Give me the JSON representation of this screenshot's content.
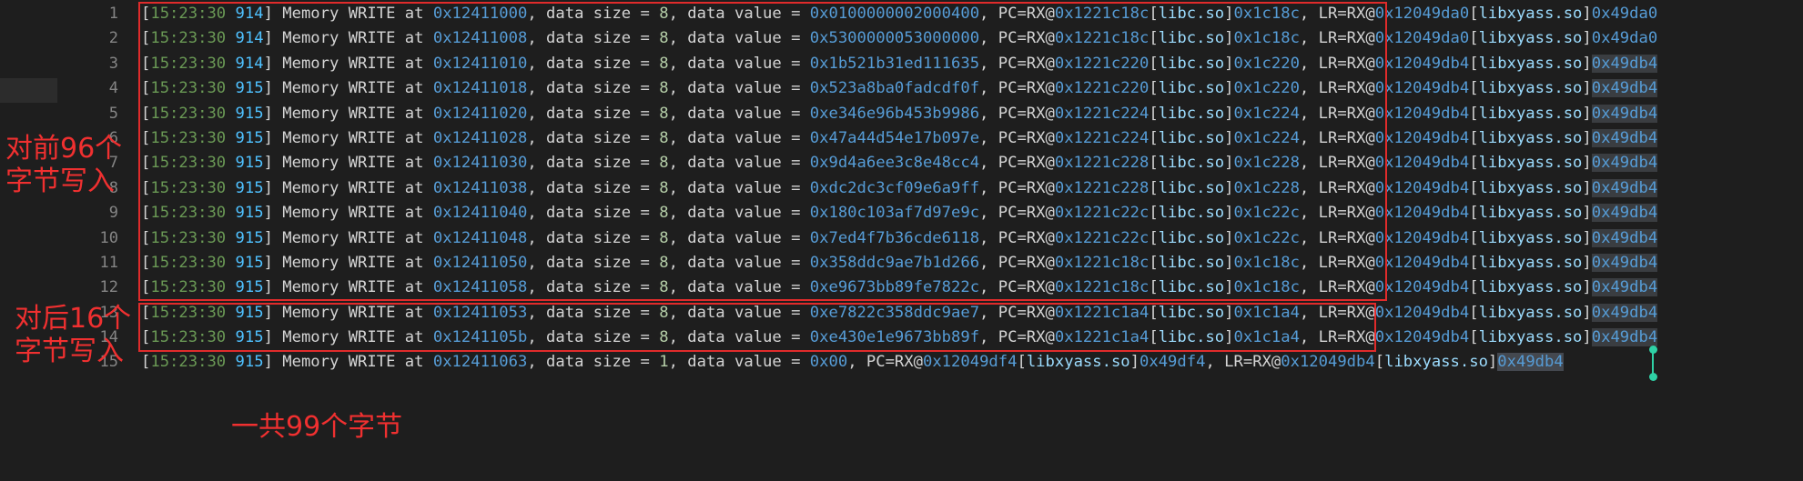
{
  "gutter": {
    "line_numbers": [
      "1",
      "2",
      "3",
      "4",
      "5",
      "6",
      "7",
      "8",
      "9",
      "10",
      "11",
      "12",
      "13",
      "14",
      "15"
    ]
  },
  "log_lines": [
    {
      "ts": "15:23:30",
      "ms": "914",
      "addr": "0x12411000",
      "size": "8",
      "value": "0x0100000002000400",
      "pc": "0x1221c18c",
      "pc_lib": "libc.so",
      "pc_off": "0x1c18c",
      "lr": "0x12049da0",
      "lr_lib": "libxyass.so",
      "lr_off": "0x49da0"
    },
    {
      "ts": "15:23:30",
      "ms": "914",
      "addr": "0x12411008",
      "size": "8",
      "value": "0x5300000053000000",
      "pc": "0x1221c18c",
      "pc_lib": "libc.so",
      "pc_off": "0x1c18c",
      "lr": "0x12049da0",
      "lr_lib": "libxyass.so",
      "lr_off": "0x49da0"
    },
    {
      "ts": "15:23:30",
      "ms": "914",
      "addr": "0x12411010",
      "size": "8",
      "value": "0x1b521b31ed111635",
      "pc": "0x1221c220",
      "pc_lib": "libc.so",
      "pc_off": "0x1c220",
      "lr": "0x12049db4",
      "lr_lib": "libxyass.so",
      "lr_off": "0x49db4"
    },
    {
      "ts": "15:23:30",
      "ms": "915",
      "addr": "0x12411018",
      "size": "8",
      "value": "0x523a8ba0fadcdf0f",
      "pc": "0x1221c220",
      "pc_lib": "libc.so",
      "pc_off": "0x1c220",
      "lr": "0x12049db4",
      "lr_lib": "libxyass.so",
      "lr_off": "0x49db4"
    },
    {
      "ts": "15:23:30",
      "ms": "915",
      "addr": "0x12411020",
      "size": "8",
      "value": "0xe346e96b453b9986",
      "pc": "0x1221c224",
      "pc_lib": "libc.so",
      "pc_off": "0x1c224",
      "lr": "0x12049db4",
      "lr_lib": "libxyass.so",
      "lr_off": "0x49db4"
    },
    {
      "ts": "15:23:30",
      "ms": "915",
      "addr": "0x12411028",
      "size": "8",
      "value": "0x47a44d54e17b097e",
      "pc": "0x1221c224",
      "pc_lib": "libc.so",
      "pc_off": "0x1c224",
      "lr": "0x12049db4",
      "lr_lib": "libxyass.so",
      "lr_off": "0x49db4"
    },
    {
      "ts": "15:23:30",
      "ms": "915",
      "addr": "0x12411030",
      "size": "8",
      "value": "0x9d4a6ee3c8e48cc4",
      "pc": "0x1221c228",
      "pc_lib": "libc.so",
      "pc_off": "0x1c228",
      "lr": "0x12049db4",
      "lr_lib": "libxyass.so",
      "lr_off": "0x49db4"
    },
    {
      "ts": "15:23:30",
      "ms": "915",
      "addr": "0x12411038",
      "size": "8",
      "value": "0xdc2dc3cf09e6a9ff",
      "pc": "0x1221c228",
      "pc_lib": "libc.so",
      "pc_off": "0x1c228",
      "lr": "0x12049db4",
      "lr_lib": "libxyass.so",
      "lr_off": "0x49db4"
    },
    {
      "ts": "15:23:30",
      "ms": "915",
      "addr": "0x12411040",
      "size": "8",
      "value": "0x180c103af7d97e9c",
      "pc": "0x1221c22c",
      "pc_lib": "libc.so",
      "pc_off": "0x1c22c",
      "lr": "0x12049db4",
      "lr_lib": "libxyass.so",
      "lr_off": "0x49db4"
    },
    {
      "ts": "15:23:30",
      "ms": "915",
      "addr": "0x12411048",
      "size": "8",
      "value": "0x7ed4f7b36cde6118",
      "pc": "0x1221c22c",
      "pc_lib": "libc.so",
      "pc_off": "0x1c22c",
      "lr": "0x12049db4",
      "lr_lib": "libxyass.so",
      "lr_off": "0x49db4"
    },
    {
      "ts": "15:23:30",
      "ms": "915",
      "addr": "0x12411050",
      "size": "8",
      "value": "0x358ddc9ae7b1d266",
      "pc": "0x1221c18c",
      "pc_lib": "libc.so",
      "pc_off": "0x1c18c",
      "lr": "0x12049db4",
      "lr_lib": "libxyass.so",
      "lr_off": "0x49db4"
    },
    {
      "ts": "15:23:30",
      "ms": "915",
      "addr": "0x12411058",
      "size": "8",
      "value": "0xe9673bb89fe7822c",
      "pc": "0x1221c18c",
      "pc_lib": "libc.so",
      "pc_off": "0x1c18c",
      "lr": "0x12049db4",
      "lr_lib": "libxyass.so",
      "lr_off": "0x49db4"
    },
    {
      "ts": "15:23:30",
      "ms": "915",
      "addr": "0x12411053",
      "size": "8",
      "value": "0xe7822c358ddc9ae7",
      "pc": "0x1221c1a4",
      "pc_lib": "libc.so",
      "pc_off": "0x1c1a4",
      "lr": "0x12049db4",
      "lr_lib": "libxyass.so",
      "lr_off": "0x49db4"
    },
    {
      "ts": "15:23:30",
      "ms": "915",
      "addr": "0x1241105b",
      "size": "8",
      "value": "0xe430e1e9673bb89f",
      "pc": "0x1221c1a4",
      "pc_lib": "libc.so",
      "pc_off": "0x1c1a4",
      "lr": "0x12049db4",
      "lr_lib": "libxyass.so",
      "lr_off": "0x49db4"
    },
    {
      "ts": "15:23:30",
      "ms": "915",
      "addr": "0x12411063",
      "size": "1",
      "value": "0x00",
      "pc": "0x12049df4",
      "pc_lib": "libxyass.so",
      "pc_off": "0x49df4",
      "lr": "0x12049db4",
      "lr_lib": "libxyass.so",
      "lr_off": "0x49db4"
    }
  ],
  "syntax": {
    "open_bracket": "[",
    "close_bracket_space": "] ",
    "space": " ",
    "memory_write": "Memory WRITE at ",
    "data_size_label": ", data size = ",
    "data_value_label": ", data value = ",
    "pc_label": ", PC=RX@",
    "lr_label": ", LR=RX@",
    "lib_open": "[",
    "lib_close": "]"
  },
  "annotations": {
    "first_96": "对前96个\n字节写入",
    "last_16": "对后16个\n字节写入",
    "total": "一共99个字节"
  },
  "colors": {
    "background": "#1e1e1e",
    "annotation_red": "#e02b2b",
    "timestamp_green": "#6a9955",
    "hex_blue": "#569cd6",
    "number_green": "#b5cea8",
    "cursor_teal": "#2fd1a6"
  }
}
